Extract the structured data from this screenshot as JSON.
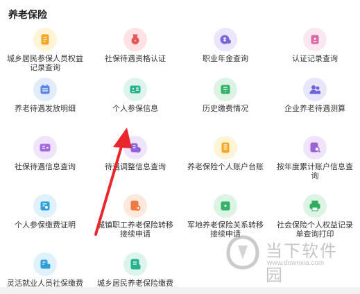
{
  "section_title": "养老保险",
  "items": [
    {
      "label": "城乡居民参保人员权益\n记录查询",
      "icon": "document-icon",
      "bg": "#fff4d6",
      "fg": "#f5a623"
    },
    {
      "label": "社保待遇资格认证",
      "icon": "medal-icon",
      "bg": "#fde3e3",
      "fg": "#e8575a"
    },
    {
      "label": "职业年金查询",
      "icon": "coin-icon",
      "bg": "#ebe6fb",
      "fg": "#7d66d9"
    },
    {
      "label": "认证记录查询",
      "icon": "record-icon",
      "bg": "#fbe7f2",
      "fg": "#d96aa5"
    },
    {
      "label": "养老待遇发放明细",
      "icon": "calendar-icon",
      "bg": "#e3ecfb",
      "fg": "#5b86e5"
    },
    {
      "label": "个人参保信息",
      "icon": "id-card-icon",
      "bg": "#ddf4ee",
      "fg": "#26b28c"
    },
    {
      "label": "历史缴费情况",
      "icon": "payment-history-icon",
      "bg": "#ddf4e4",
      "fg": "#34b26a"
    },
    {
      "label": "企业养老待遇测算",
      "icon": "people-icon",
      "bg": "#e8e6fb",
      "fg": "#6e63d9"
    },
    {
      "label": "社保待遇信息查询",
      "icon": "info-card-icon",
      "bg": "#efe4fb",
      "fg": "#a36ae0"
    },
    {
      "label": "待遇调整信息查询",
      "icon": "adjust-icon",
      "bg": "#efe4fb",
      "fg": "#8e63d9"
    },
    {
      "label": "养老保险个人账户台账",
      "icon": "ledger-icon",
      "bg": "#fff4d6",
      "fg": "#f5a623"
    },
    {
      "label": "按年度累计账户信息查\n询",
      "icon": "search-doc-icon",
      "bg": "#efe4fb",
      "fg": "#9c63d9"
    },
    {
      "label": "个人参保缴费证明",
      "icon": "certificate-icon",
      "bg": "#dff1fb",
      "fg": "#2e9fd8"
    },
    {
      "label": "城镇职工养老保险转移\n接续申请",
      "icon": "transfer-icon",
      "bg": "#fde8dd",
      "fg": "#ee7a3f"
    },
    {
      "label": "军地养老保险关系转移\n接续申请",
      "icon": "military-transfer-icon",
      "bg": "#ddf4e4",
      "fg": "#34b26a"
    },
    {
      "label": "社会保险个人权益记录\n单查询打印",
      "icon": "print-icon",
      "bg": "#ddf4e4",
      "fg": "#2fae5f"
    },
    {
      "label": "灵活就业人员社保缴费",
      "icon": "flexible-pay-icon",
      "bg": "#dff1fb",
      "fg": "#2e9fd8"
    },
    {
      "label": "城乡居民养老保险缴费",
      "icon": "resident-pay-icon",
      "bg": "#ddf4ee",
      "fg": "#26b28c"
    }
  ],
  "watermark": {
    "text": "当下软件园",
    "url": "www.downxia.com"
  }
}
